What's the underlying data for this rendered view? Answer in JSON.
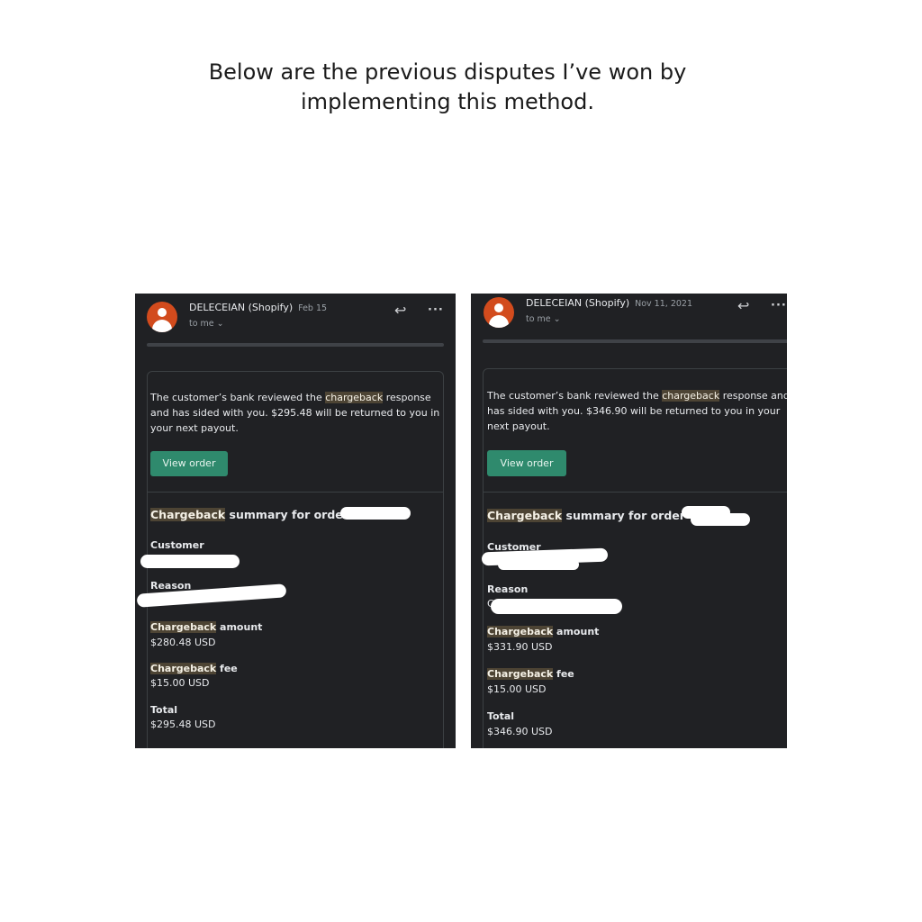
{
  "caption": {
    "line1": "Below are the previous disputes I’ve won by",
    "line2": "implementing this method."
  },
  "colors": {
    "email_background": "#202124",
    "highlight": "#4d4434",
    "button": "#2f8a6d",
    "avatar": "#d24b1d"
  },
  "emails": [
    {
      "sender": "DELECEIAN (Shopify)",
      "date": "Feb 15",
      "to": "to me ⌄",
      "msg_pre": "The customer’s bank reviewed the ",
      "msg_hl": "chargeback",
      "msg_post": " response and has sided with you. $295.48 will be returned to you in your next payout.",
      "button": "View order",
      "summary_hl": "Chargeback",
      "summary_rest": " summary for order #",
      "customer_label": "Customer",
      "reason_label": "Reason",
      "reason_partial": "",
      "amount_hl": "Chargeback",
      "amount_rest": " amount",
      "amount_value": "$280.48 USD",
      "fee_hl": "Chargeback",
      "fee_rest": " fee",
      "fee_value": "$15.00 USD",
      "total_label": "Total",
      "total_value": "$295.48 USD"
    },
    {
      "sender": "DELECEIAN (Shopify)",
      "date": "Nov 11, 2021",
      "to": "to me ⌄",
      "msg_pre": "The customer’s bank reviewed the ",
      "msg_hl": "chargeback",
      "msg_post": " response and has sided with you. $346.90 will be returned to you in your next payout.",
      "button": "View order",
      "summary_hl": "Chargeback",
      "summary_rest": " summary for order #",
      "customer_label": "Customer",
      "reason_label": "Reason",
      "reason_partial": "C",
      "amount_hl": "Chargeback",
      "amount_rest": " amount",
      "amount_value": "$331.90 USD",
      "fee_hl": "Chargeback",
      "fee_rest": " fee",
      "fee_value": "$15.00 USD",
      "total_label": "Total",
      "total_value": "$346.90 USD"
    }
  ]
}
